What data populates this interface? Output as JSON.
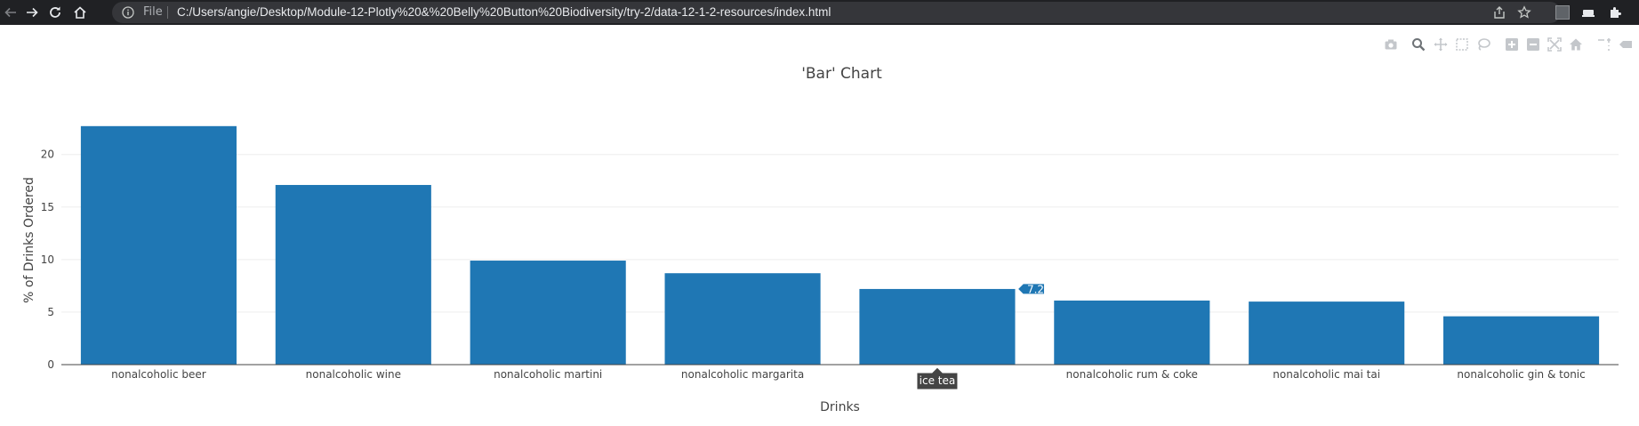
{
  "browser": {
    "file_label": "File",
    "url": "C:/Users/angie/Desktop/Module-12-Plotly%20&%20Belly%20Button%20Biodiversity/try-2/data-12-1-2-resources/index.html"
  },
  "modebar": {
    "icons": [
      "camera-icon",
      "zoom-icon",
      "pan-icon",
      "box-select-icon",
      "lasso-select-icon",
      "zoom-in-icon",
      "zoom-out-icon",
      "autoscale-icon",
      "reset-axes-icon",
      "spike-lines-icon",
      "compare-hover-icon"
    ]
  },
  "colors": {
    "bar": "#1f77b4",
    "hover_label_bg": "#444444",
    "grid": "#eeeeee",
    "text": "#444444"
  },
  "chart_data": {
    "type": "bar",
    "title": "'Bar' Chart",
    "xlabel": "Drinks",
    "ylabel": "% of Drinks Ordered",
    "categories": [
      "nonalcoholic beer",
      "nonalcoholic wine",
      "nonalcoholic martini",
      "nonalcoholic margarita",
      "ice tea",
      "nonalcoholic rum & coke",
      "nonalcoholic mai tai",
      "nonalcoholic gin & tonic"
    ],
    "values": [
      22.7,
      17.1,
      9.9,
      8.7,
      7.2,
      6.1,
      6.0,
      4.6
    ],
    "ylim": [
      0,
      23.7
    ],
    "yticks": [
      0,
      5,
      10,
      15,
      20
    ],
    "grid": "y-axis horizontal",
    "hover": {
      "category_index": 4,
      "category_label": "ice tea",
      "value_label": "7.2"
    }
  }
}
